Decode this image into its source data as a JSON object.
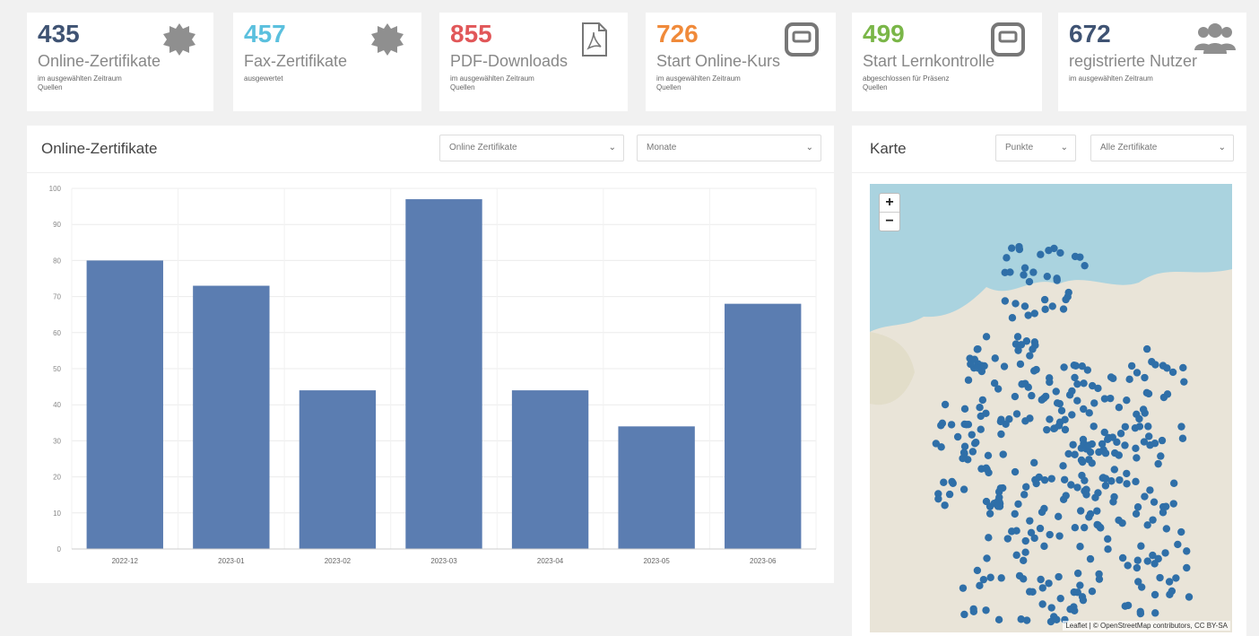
{
  "colors": {
    "bar": "#5b7db1",
    "card_dark": "#3f5373",
    "card_lightblue": "#5bc0de",
    "card_red": "#e15759",
    "card_orange": "#f08a3a",
    "card_green": "#7ab648",
    "map_dot": "#2f6fa8"
  },
  "cards": [
    {
      "value": "435",
      "label": "Online-Zertifikate",
      "sub1": "im ausgewählten Zeitraum",
      "sub2": "Quellen",
      "icon": "gear-icon"
    },
    {
      "value": "457",
      "label": "Fax-Zertifikate",
      "sub1": "ausgewertet",
      "sub2": "",
      "icon": "gear-icon"
    },
    {
      "value": "855",
      "label": "PDF-Downloads",
      "sub1": "im ausgewählten Zeitraum",
      "sub2": "Quellen",
      "icon": "pdf-icon"
    },
    {
      "value": "726",
      "label": "Start Online-Kurs",
      "sub1": "im ausgewählten Zeitraum",
      "sub2": "Quellen",
      "icon": "window-icon"
    },
    {
      "value": "499",
      "label": "Start Lernkontrolle",
      "sub1": "abgeschlossen für Präsenz",
      "sub2": "Quellen",
      "icon": "window-icon"
    },
    {
      "value": "672",
      "label": "registrierte Nutzer",
      "sub1": "im ausgewählten Zeitraum",
      "sub2": "",
      "icon": "users-icon"
    }
  ],
  "chart_panel": {
    "title": "Online-Zertifikate",
    "select1": "Online Zertifikate",
    "select2": "Monate"
  },
  "map_panel": {
    "title": "Karte",
    "select1": "Punkte",
    "select2": "Alle Zertifikate",
    "zoom_in": "+",
    "zoom_out": "−",
    "attribution": "Leaflet | © OpenStreetMap contributors, CC BY-SA"
  },
  "chart_data": {
    "type": "bar",
    "categories": [
      "2022-12",
      "2023-01",
      "2023-02",
      "2023-03",
      "2023-04",
      "2023-05",
      "2023-06"
    ],
    "values": [
      80,
      73,
      44,
      97,
      44,
      34,
      68
    ],
    "ylim": [
      0,
      100
    ],
    "yticks": [
      0,
      10,
      20,
      30,
      40,
      50,
      60,
      70,
      80,
      90,
      100
    ],
    "grid": true
  }
}
